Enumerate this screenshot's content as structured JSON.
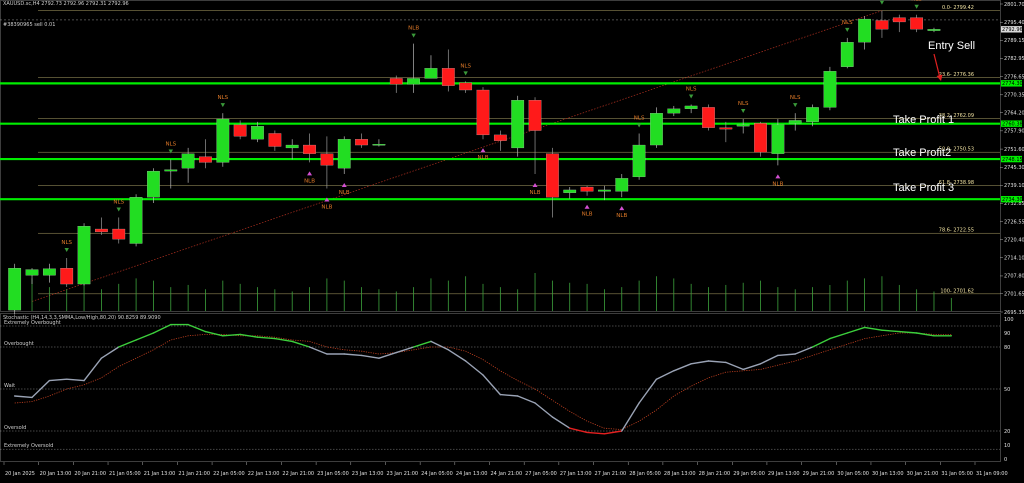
{
  "header": {
    "symbol_line": "XAUUSD.sc,H4  2792.73 2792.96 2792.31 2792.96",
    "order_line": "#38390965 sell 0.01",
    "stoch_line": "Stochastic (H4,14,3,3,SMMA,Low/High,80,20) 90.8259 89.9090"
  },
  "annotations": {
    "entry_sell": "Entry Sell",
    "tp1": "Take Profit 1",
    "tp2": "Take Profit2",
    "tp3": "Take Profit 3"
  },
  "fib_labels": [
    {
      "text": "0.0- 2799.42",
      "price": 2799.42
    },
    {
      "text": "23.6- 2776.36",
      "price": 2776.36
    },
    {
      "text": "38.2- 2762.09",
      "price": 2762.09
    },
    {
      "text": "50.0- 2750.53",
      "price": 2750.53
    },
    {
      "text": "61.8- 2738.98",
      "price": 2738.98
    },
    {
      "text": "78.6- 2722.55",
      "price": 2722.55
    },
    {
      "text": "100- 2701.62",
      "price": 2701.62
    }
  ],
  "hline_tags": [
    {
      "text": "2792.96",
      "price": 2792.96
    },
    {
      "text": "2774.30",
      "price": 2774.3
    },
    {
      "text": "2760.38",
      "price": 2760.38
    },
    {
      "text": "2748.15",
      "price": 2748.15
    },
    {
      "text": "2734.30",
      "price": 2734.3
    }
  ],
  "price_axis": [
    "2801.70",
    "2795.40",
    "2789.15",
    "2782.95",
    "2776.65",
    "2770.35",
    "2764.20",
    "2757.90",
    "2751.60",
    "2745.30",
    "2739.10",
    "2732.85",
    "2726.55",
    "2720.40",
    "2714.10",
    "2707.80",
    "2701.65",
    "2695.35"
  ],
  "stoch_axis": [
    "100",
    "90",
    "80",
    "50",
    "20",
    "10",
    "0"
  ],
  "stoch_levels": {
    "extremely_overbought": "Extremely Overbought",
    "overbought": "Overbought",
    "wait": "Wait",
    "oversold": "Oversold",
    "extremely_oversold": "Extremely Oversold"
  },
  "time_axis": [
    "20 Jan 2025",
    "20 Jan 13:00",
    "20 Jan 21:00",
    "21 Jan 05:00",
    "21 Jan 13:00",
    "21 Jan 21:00",
    "22 Jan 05:00",
    "22 Jan 13:00",
    "22 Jan 21:00",
    "23 Jan 05:00",
    "23 Jan 13:00",
    "23 Jan 21:00",
    "24 Jan 05:00",
    "24 Jan 13:00",
    "24 Jan 21:00",
    "27 Jan 05:00",
    "27 Jan 13:00",
    "27 Jan 21:00",
    "28 Jan 05:00",
    "28 Jan 13:00",
    "28 Jan 21:00",
    "29 Jan 05:00",
    "29 Jan 13:00",
    "29 Jan 21:00",
    "30 Jan 05:00",
    "30 Jan 13:00",
    "30 Jan 21:00",
    "31 Jan 05:00",
    "31 Jan 09:00"
  ],
  "colors": {
    "bull": "#22dd22",
    "bear": "#ff1a1a",
    "level_line": "#00ee00",
    "fib": "#e8d98a",
    "stoch_main": "#9aa3b5",
    "stoch_over": "#3ccf3c",
    "stoch_under": "#e52020",
    "signal": "#c04020",
    "arrow_up": "#d24fd2",
    "volume": "#3da33d"
  },
  "chart_data": {
    "type": "candlestick",
    "title": "XAUUSD.sc,H4",
    "ylim": [
      2695.35,
      2801.7
    ],
    "candles": [
      {
        "o": 2696.0,
        "h": 2712.0,
        "l": 2694.5,
        "c": 2710.5
      },
      {
        "o": 2708.0,
        "h": 2710.5,
        "l": 2705.0,
        "c": 2710.0
      },
      {
        "o": 2708.0,
        "h": 2712.0,
        "l": 2705.5,
        "c": 2710.3
      },
      {
        "o": 2710.5,
        "h": 2714.0,
        "l": 2704.0,
        "c": 2705.0
      },
      {
        "o": 2705.0,
        "h": 2726.0,
        "l": 2704.5,
        "c": 2725.0
      },
      {
        "o": 2724.0,
        "h": 2728.0,
        "l": 2722.0,
        "c": 2723.0
      },
      {
        "o": 2724.0,
        "h": 2728.0,
        "l": 2719.0,
        "c": 2720.5
      },
      {
        "o": 2719.0,
        "h": 2736.0,
        "l": 2718.0,
        "c": 2735.0
      },
      {
        "o": 2735.0,
        "h": 2745.0,
        "l": 2733.0,
        "c": 2744.0
      },
      {
        "o": 2744.0,
        "h": 2748.0,
        "l": 2738.0,
        "c": 2744.5
      },
      {
        "o": 2745.0,
        "h": 2752.0,
        "l": 2740.0,
        "c": 2750.0
      },
      {
        "o": 2749.0,
        "h": 2755.0,
        "l": 2745.0,
        "c": 2747.0
      },
      {
        "o": 2747.0,
        "h": 2764.0,
        "l": 2745.5,
        "c": 2762.0
      },
      {
        "o": 2760.0,
        "h": 2761.5,
        "l": 2755.0,
        "c": 2756.0
      },
      {
        "o": 2755.0,
        "h": 2761.0,
        "l": 2754.0,
        "c": 2759.5
      },
      {
        "o": 2757.0,
        "h": 2758.0,
        "l": 2751.0,
        "c": 2752.5
      },
      {
        "o": 2752.0,
        "h": 2755.0,
        "l": 2748.0,
        "c": 2753.0
      },
      {
        "o": 2753.0,
        "h": 2757.0,
        "l": 2747.0,
        "c": 2750.0
      },
      {
        "o": 2750.0,
        "h": 2756.0,
        "l": 2738.0,
        "c": 2746.0
      },
      {
        "o": 2745.0,
        "h": 2756.0,
        "l": 2743.0,
        "c": 2755.0
      },
      {
        "o": 2755.0,
        "h": 2757.0,
        "l": 2752.0,
        "c": 2753.0
      },
      {
        "o": 2753.0,
        "h": 2755.0,
        "l": 2752.5,
        "c": 2753.3
      },
      {
        "o": 2776.0,
        "h": 2777.0,
        "l": 2771.0,
        "c": 2774.0
      },
      {
        "o": 2774.0,
        "h": 2788.0,
        "l": 2771.0,
        "c": 2776.0
      },
      {
        "o": 2776.0,
        "h": 2784.0,
        "l": 2776.0,
        "c": 2779.5
      },
      {
        "o": 2779.5,
        "h": 2786.0,
        "l": 2771.5,
        "c": 2773.5
      },
      {
        "o": 2774.5,
        "h": 2775.0,
        "l": 2771.0,
        "c": 2772.0
      },
      {
        "o": 2772.0,
        "h": 2773.0,
        "l": 2755.0,
        "c": 2756.5
      },
      {
        "o": 2756.5,
        "h": 2758.0,
        "l": 2751.0,
        "c": 2754.5
      },
      {
        "o": 2752.0,
        "h": 2770.0,
        "l": 2749.0,
        "c": 2768.5
      },
      {
        "o": 2768.5,
        "h": 2769.5,
        "l": 2743.0,
        "c": 2758.0
      },
      {
        "o": 2750.0,
        "h": 2752.0,
        "l": 2728.0,
        "c": 2735.0
      },
      {
        "o": 2736.5,
        "h": 2738.5,
        "l": 2734.5,
        "c": 2737.5
      },
      {
        "o": 2738.5,
        "h": 2739.0,
        "l": 2735.5,
        "c": 2737.0
      },
      {
        "o": 2737.0,
        "h": 2739.0,
        "l": 2734.0,
        "c": 2737.5
      },
      {
        "o": 2737.0,
        "h": 2743.0,
        "l": 2735.0,
        "c": 2741.5
      },
      {
        "o": 2742.0,
        "h": 2757.0,
        "l": 2741.0,
        "c": 2753.0
      },
      {
        "o": 2753.0,
        "h": 2766.0,
        "l": 2752.0,
        "c": 2764.0
      },
      {
        "o": 2764.0,
        "h": 2766.5,
        "l": 2763.0,
        "c": 2765.5
      },
      {
        "o": 2765.5,
        "h": 2767.0,
        "l": 2764.0,
        "c": 2766.5
      },
      {
        "o": 2766.0,
        "h": 2767.0,
        "l": 2758.0,
        "c": 2759.0
      },
      {
        "o": 2759.0,
        "h": 2761.0,
        "l": 2754.0,
        "c": 2758.5
      },
      {
        "o": 2759.5,
        "h": 2762.0,
        "l": 2757.0,
        "c": 2760.0
      },
      {
        "o": 2760.5,
        "h": 2761.0,
        "l": 2749.0,
        "c": 2750.5
      },
      {
        "o": 2750.0,
        "h": 2762.0,
        "l": 2746.0,
        "c": 2760.0
      },
      {
        "o": 2760.5,
        "h": 2764.0,
        "l": 2758.0,
        "c": 2761.5
      },
      {
        "o": 2761.0,
        "h": 2767.0,
        "l": 2759.5,
        "c": 2766.0
      },
      {
        "o": 2766.0,
        "h": 2780.0,
        "l": 2765.0,
        "c": 2778.5
      },
      {
        "o": 2780.0,
        "h": 2790.0,
        "l": 2779.5,
        "c": 2788.5
      },
      {
        "o": 2788.5,
        "h": 2797.5,
        "l": 2786.0,
        "c": 2796.5
      },
      {
        "o": 2796.0,
        "h": 2799.4,
        "l": 2790.0,
        "c": 2793.0
      },
      {
        "o": 2797.0,
        "h": 2798.0,
        "l": 2792.0,
        "c": 2795.5
      },
      {
        "o": 2797.0,
        "h": 2798.0,
        "l": 2792.0,
        "c": 2793.0
      },
      {
        "o": 2792.5,
        "h": 2793.5,
        "l": 2792.0,
        "c": 2792.96
      }
    ],
    "stochastic_main": [
      45,
      44,
      56,
      57,
      56,
      72,
      80,
      85,
      90,
      96,
      96,
      91,
      88,
      89,
      87,
      86,
      84,
      80,
      75,
      75,
      74,
      72,
      76,
      80,
      84,
      78,
      70,
      60,
      46,
      45,
      40,
      30,
      22,
      19,
      18,
      20,
      40,
      57,
      63,
      68,
      70,
      69,
      64,
      68,
      74,
      75,
      80,
      86,
      90,
      94,
      92,
      91,
      90,
      88,
      88
    ],
    "stochastic_signal": [
      40,
      41,
      45,
      50,
      53,
      58,
      66,
      72,
      78,
      85,
      88,
      89,
      89,
      88,
      88,
      87,
      85,
      84,
      80,
      78,
      77,
      75,
      76,
      78,
      80,
      80,
      77,
      71,
      63,
      56,
      50,
      42,
      34,
      27,
      22,
      21,
      27,
      35,
      45,
      52,
      58,
      62,
      63,
      64,
      67,
      70,
      74,
      78,
      82,
      86,
      88,
      90,
      90,
      89,
      89
    ],
    "volume": [
      35,
      30,
      22,
      20,
      28,
      20,
      25,
      30,
      28,
      22,
      24,
      20,
      28,
      25,
      22,
      20,
      18,
      22,
      30,
      28,
      22,
      20,
      18,
      22,
      30,
      28,
      32,
      25,
      22,
      20,
      35,
      28,
      26,
      25,
      20,
      22,
      28,
      32,
      30,
      25,
      22,
      24,
      26,
      28,
      22,
      20,
      22,
      24,
      28,
      30,
      32,
      24,
      20,
      18,
      12
    ],
    "signals": [
      {
        "i": 3,
        "label": "NLS",
        "side": "up",
        "kind": "text"
      },
      {
        "i": 6,
        "label": "NLS",
        "side": "up",
        "kind": "text"
      },
      {
        "i": 9,
        "label": "NLS",
        "side": "up",
        "kind": "text"
      },
      {
        "i": 12,
        "label": "NLS",
        "side": "up",
        "kind": "text"
      },
      {
        "i": 17,
        "label": "NLB",
        "side": "down",
        "kind": "text"
      },
      {
        "i": 18,
        "label": "NLB",
        "side": "down",
        "kind": "text"
      },
      {
        "i": 19,
        "label": "NLB",
        "side": "down",
        "kind": "text"
      },
      {
        "i": 23,
        "label": "NLB",
        "side": "up",
        "kind": "text"
      },
      {
        "i": 26,
        "label": "NLS",
        "side": "up",
        "kind": "text"
      },
      {
        "i": 27,
        "label": "NLB",
        "side": "down",
        "kind": "text"
      },
      {
        "i": 30,
        "label": "NLB",
        "side": "down",
        "kind": "text"
      },
      {
        "i": 33,
        "label": "NLB",
        "side": "down",
        "kind": "text"
      },
      {
        "i": 35,
        "label": "NLB",
        "side": "down",
        "kind": "text"
      },
      {
        "i": 36,
        "label": "NLS",
        "side": "up",
        "kind": "text"
      },
      {
        "i": 39,
        "label": "NLS",
        "side": "up",
        "kind": "text"
      },
      {
        "i": 42,
        "label": "NLS",
        "side": "up",
        "kind": "text"
      },
      {
        "i": 44,
        "label": "NLB",
        "side": "down",
        "kind": "text"
      },
      {
        "i": 45,
        "label": "NLS",
        "side": "up",
        "kind": "text"
      },
      {
        "i": 48,
        "label": "NLS",
        "side": "up",
        "kind": "text"
      },
      {
        "i": 50,
        "label": "NLS",
        "side": "up",
        "kind": "text"
      },
      {
        "i": 52,
        "label": "NLS",
        "side": "up",
        "kind": "text"
      }
    ]
  }
}
